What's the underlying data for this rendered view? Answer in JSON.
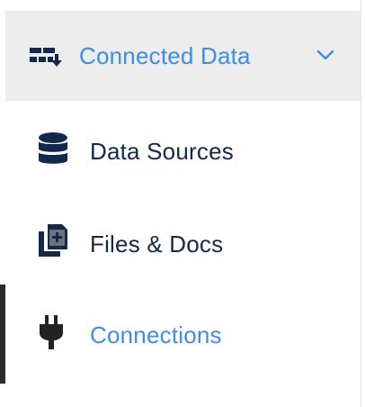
{
  "colors": {
    "accent_blue": "#3c8de8",
    "navy": "#13294b",
    "header_bg": "#ededed",
    "active_indicator": "#2b2b2b",
    "dark_icon": "#222222"
  },
  "nav": {
    "group": {
      "label": "Connected Data",
      "icon": "data-transfer-icon",
      "expanded": true,
      "chevron_icon": "chevron-down-icon"
    },
    "items": [
      {
        "label": "Data Sources",
        "icon": "database-icon",
        "active": false
      },
      {
        "label": "Files & Docs",
        "icon": "add-document-icon",
        "active": false
      },
      {
        "label": "Connections",
        "icon": "plug-icon",
        "active": true
      }
    ]
  }
}
